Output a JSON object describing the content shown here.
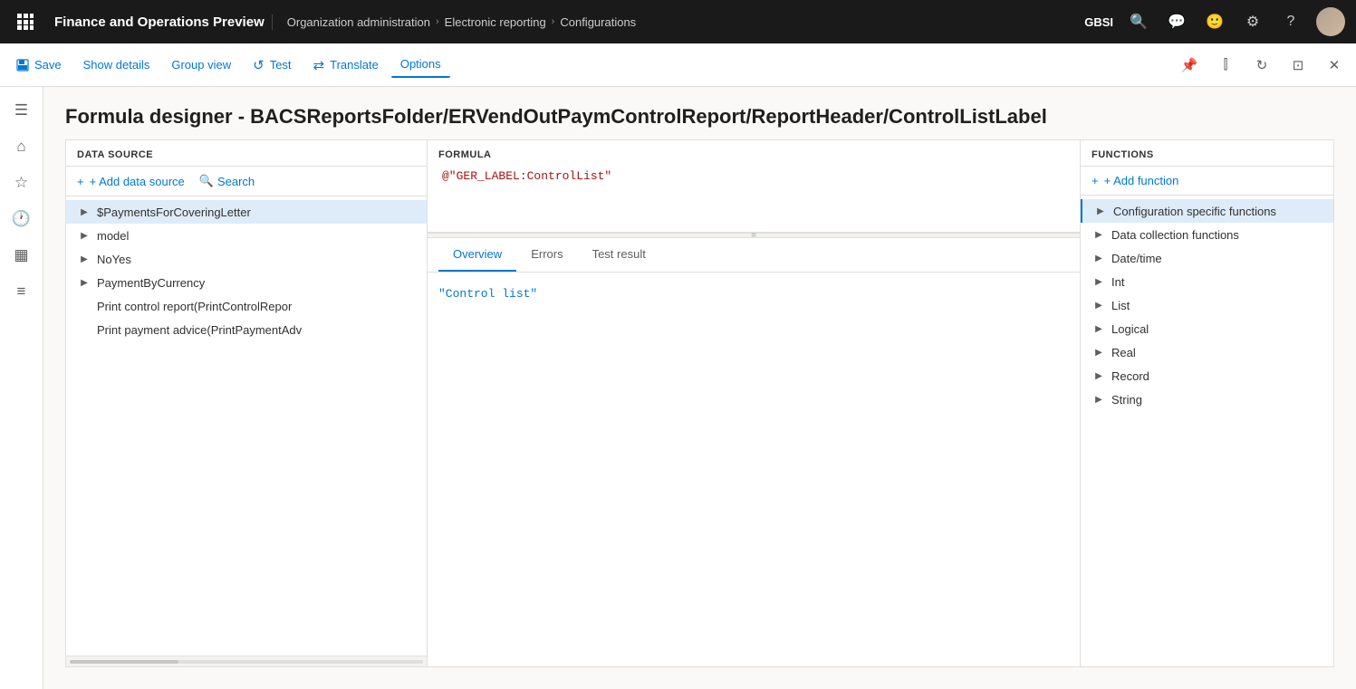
{
  "app": {
    "title": "Finance and Operations Preview"
  },
  "breadcrumb": {
    "items": [
      {
        "label": "Organization administration"
      },
      {
        "label": "Electronic reporting"
      },
      {
        "label": "Configurations"
      }
    ]
  },
  "top_right": {
    "org_code": "GBSI"
  },
  "toolbar": {
    "save_label": "Save",
    "show_details_label": "Show details",
    "group_view_label": "Group view",
    "test_label": "Test",
    "translate_label": "Translate",
    "options_label": "Options"
  },
  "page": {
    "title": "Formula designer - BACSReportsFolder/ERVendOutPaymControlReport/ReportHeader/ControlListLabel"
  },
  "datasource": {
    "header": "DATA SOURCE",
    "add_btn": "+ Add data source",
    "search_btn": "Search",
    "items": [
      {
        "id": "payments",
        "label": "$PaymentsForCoveringLetter",
        "has_children": true,
        "selected": true
      },
      {
        "id": "model",
        "label": "model",
        "has_children": true,
        "selected": false
      },
      {
        "id": "noyes",
        "label": "NoYes",
        "has_children": true,
        "selected": false
      },
      {
        "id": "payment_by_currency",
        "label": "PaymentByCurrency",
        "has_children": true,
        "selected": false
      },
      {
        "id": "print_control",
        "label": "Print control report(PrintControlRepor",
        "has_children": false,
        "selected": false
      },
      {
        "id": "print_payment",
        "label": "Print payment advice(PrintPaymentAdv",
        "has_children": false,
        "selected": false
      }
    ]
  },
  "formula": {
    "label": "FORMULA",
    "value": "@\"GER_LABEL:ControlList\""
  },
  "tabs": {
    "overview_label": "Overview",
    "errors_label": "Errors",
    "test_result_label": "Test result",
    "active": "overview"
  },
  "overview_result": "\"Control list\"",
  "functions": {
    "header": "FUNCTIONS",
    "add_btn": "+ Add function",
    "items": [
      {
        "id": "config_specific",
        "label": "Configuration specific functions",
        "has_children": true,
        "selected": true
      },
      {
        "id": "data_collection",
        "label": "Data collection functions",
        "has_children": true,
        "selected": false
      },
      {
        "id": "datetime",
        "label": "Date/time",
        "has_children": true,
        "selected": false
      },
      {
        "id": "int",
        "label": "Int",
        "has_children": true,
        "selected": false
      },
      {
        "id": "list",
        "label": "List",
        "has_children": true,
        "selected": false
      },
      {
        "id": "logical",
        "label": "Logical",
        "has_children": true,
        "selected": false
      },
      {
        "id": "real",
        "label": "Real",
        "has_children": true,
        "selected": false
      },
      {
        "id": "record",
        "label": "Record",
        "has_children": true,
        "selected": false
      },
      {
        "id": "string",
        "label": "String",
        "has_children": true,
        "selected": false
      }
    ]
  },
  "icons": {
    "grid": "⊞",
    "save": "💾",
    "search": "🔍",
    "test": "↺",
    "translate": "⇄",
    "pin": "📌",
    "expand": "⤢",
    "refresh": "↻",
    "new_window": "⊡",
    "close": "✕",
    "chevron_right": "▶",
    "plus": "+",
    "menu": "☰",
    "home": "⌂",
    "favorites": "☆",
    "recent": "🕐",
    "workspaces": "▦",
    "modules": "≡"
  }
}
